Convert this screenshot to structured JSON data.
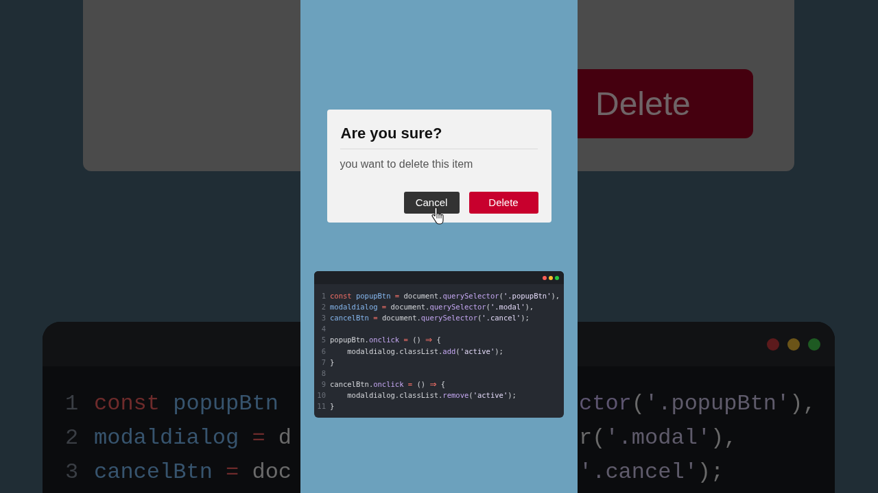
{
  "backdrop_left": {
    "code_lines": [
      {
        "number": "1",
        "tokens": [
          {
            "kind": "keyword",
            "text": "const "
          },
          {
            "kind": "variable",
            "text": "popupBtn"
          }
        ]
      },
      {
        "number": "2",
        "tokens": [
          {
            "kind": "variable",
            "text": "modaldialog "
          },
          {
            "kind": "operator",
            "text": "= "
          },
          {
            "kind": "plain",
            "text": "d"
          }
        ]
      },
      {
        "number": "3",
        "tokens": [
          {
            "kind": "variable",
            "text": "cancelBtn "
          },
          {
            "kind": "operator",
            "text": "= "
          },
          {
            "kind": "plain",
            "text": "doc"
          }
        ]
      }
    ]
  },
  "modal": {
    "title": "Are you sure?",
    "message": "you want to delete this item",
    "buttons": [
      {
        "label": "Cancel",
        "kind": "secondary",
        "hovered": true
      },
      {
        "label": "Delete",
        "kind": "danger",
        "hovered": false
      }
    ]
  },
  "code_window": {
    "dots": [
      {
        "color": "#ff5f57"
      },
      {
        "color": "#febc2e"
      },
      {
        "color": "#28c840"
      }
    ],
    "lines": [
      {
        "number": "1",
        "tokens": [
          {
            "kind": "keyword",
            "text": "const "
          },
          {
            "kind": "variable",
            "text": "popupBtn "
          },
          {
            "kind": "operator",
            "text": "= "
          },
          {
            "kind": "plain",
            "text": "document."
          },
          {
            "kind": "method",
            "text": "querySelector"
          },
          {
            "kind": "plain",
            "text": "("
          },
          {
            "kind": "string",
            "text": "'.popupBtn'"
          },
          {
            "kind": "plain",
            "text": "),"
          }
        ]
      },
      {
        "number": "2",
        "tokens": [
          {
            "kind": "variable",
            "text": "modaldialog "
          },
          {
            "kind": "operator",
            "text": "= "
          },
          {
            "kind": "plain",
            "text": "document."
          },
          {
            "kind": "method",
            "text": "querySelector"
          },
          {
            "kind": "plain",
            "text": "("
          },
          {
            "kind": "string",
            "text": "'.modal'"
          },
          {
            "kind": "plain",
            "text": "),"
          }
        ]
      },
      {
        "number": "3",
        "tokens": [
          {
            "kind": "variable",
            "text": "cancelBtn "
          },
          {
            "kind": "operator",
            "text": "= "
          },
          {
            "kind": "plain",
            "text": "document."
          },
          {
            "kind": "method",
            "text": "querySelector"
          },
          {
            "kind": "plain",
            "text": "("
          },
          {
            "kind": "string",
            "text": "'.cancel'"
          },
          {
            "kind": "plain",
            "text": ");"
          }
        ]
      },
      {
        "number": "4"
      },
      {
        "number": "5",
        "tokens": [
          {
            "kind": "plain",
            "text": "popupBtn."
          },
          {
            "kind": "method",
            "text": "onclick "
          },
          {
            "kind": "operator",
            "text": "= "
          },
          {
            "kind": "plain",
            "text": "() "
          },
          {
            "kind": "arrow",
            "text": "⇒"
          },
          {
            "kind": "plain",
            "text": " {"
          }
        ]
      },
      {
        "number": "6",
        "tokens": [
          {
            "kind": "plain",
            "text": "    modaldialog.classList."
          },
          {
            "kind": "method",
            "text": "add"
          },
          {
            "kind": "plain",
            "text": "("
          },
          {
            "kind": "string",
            "text": "'active'"
          },
          {
            "kind": "plain",
            "text": ");"
          }
        ]
      },
      {
        "number": "7",
        "tokens": [
          {
            "kind": "plain",
            "text": "}"
          }
        ]
      },
      {
        "number": "8"
      },
      {
        "number": "9",
        "tokens": [
          {
            "kind": "plain",
            "text": "cancelBtn."
          },
          {
            "kind": "method",
            "text": "onclick "
          },
          {
            "kind": "operator",
            "text": "= "
          },
          {
            "kind": "plain",
            "text": "() "
          },
          {
            "kind": "arrow",
            "text": "⇒"
          },
          {
            "kind": "plain",
            "text": " {"
          }
        ]
      },
      {
        "number": "10",
        "tokens": [
          {
            "kind": "plain",
            "text": "    modaldialog.classList."
          },
          {
            "kind": "method",
            "text": "remove"
          },
          {
            "kind": "plain",
            "text": "("
          },
          {
            "kind": "string",
            "text": "'active'"
          },
          {
            "kind": "plain",
            "text": ");"
          }
        ]
      },
      {
        "number": "11",
        "tokens": [
          {
            "kind": "plain",
            "text": "}"
          }
        ]
      }
    ]
  },
  "backdrop_right": {
    "button": "Delete",
    "dots": [
      {
        "color": "#5c1a1c"
      },
      {
        "color": "#6b5418"
      },
      {
        "color": "#1e5a22"
      }
    ],
    "code_lines": [
      {
        "tokens": [
          {
            "kind": "method",
            "text": "ctor"
          },
          {
            "kind": "plain",
            "text": "("
          },
          {
            "kind": "string",
            "text": "'.popupBtn'"
          },
          {
            "kind": "plain",
            "text": "),"
          }
        ]
      },
      {
        "tokens": [
          {
            "kind": "plain",
            "text": "r("
          },
          {
            "kind": "string",
            "text": "'.modal'"
          },
          {
            "kind": "plain",
            "text": "),"
          }
        ]
      },
      {
        "tokens": [
          {
            "kind": "string",
            "text": "'.cancel'"
          },
          {
            "kind": "plain",
            "text": ");"
          }
        ]
      }
    ]
  }
}
